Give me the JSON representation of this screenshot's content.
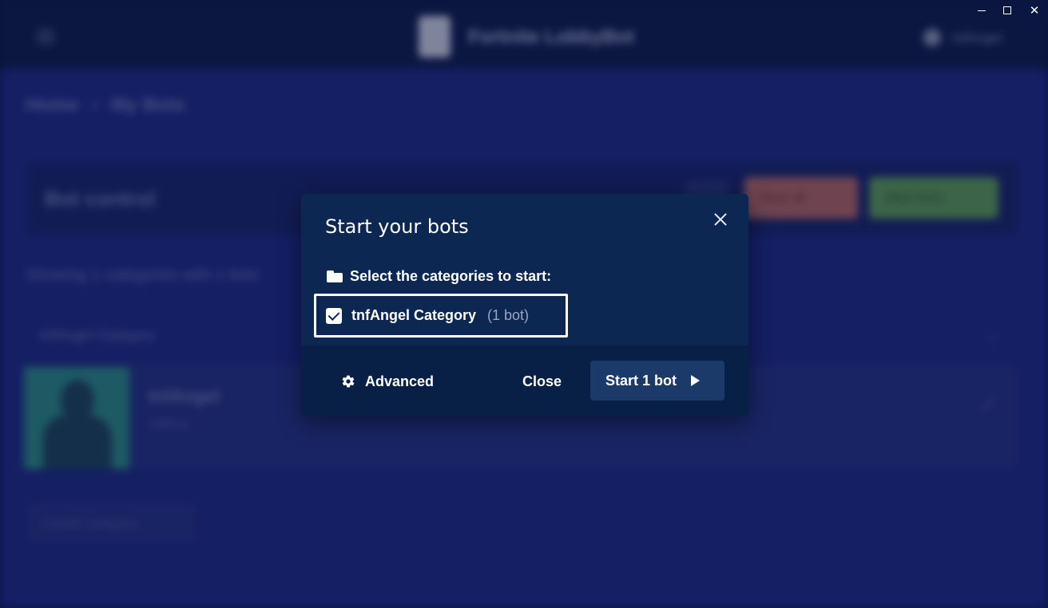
{
  "background": {
    "app_title": "Fortnite LobbyBot",
    "user_name": "tnfAngel",
    "breadcrumb": [
      "Home",
      "My Bots"
    ],
    "breadcrumb_separator": "›",
    "control_title": "Bot control",
    "stop_all_label": "Stop all",
    "start_bots_label": "Start bots",
    "showing_text": "Showing 1 categories with 1 bots",
    "category_row_text": "tnfAngel Category",
    "bot_name": "tnfAngel",
    "bot_status": "Offline",
    "create_category_label": "Create category",
    "colors": {
      "app_bg": "#1e2a8a",
      "topbar_bg": "#0f1d52",
      "stop_button": "#b0666a",
      "start_button": "#5e9a5e"
    }
  },
  "window_controls": {
    "minimize_icon": "minimize-icon",
    "maximize_icon": "maximize-icon",
    "close_symbol": "✕"
  },
  "dialog": {
    "title": "Start your bots",
    "section_label": "Select the categories to start:",
    "section_icon": "folder-icon",
    "categories": [
      {
        "name": "tnfAngel Category",
        "count": "(1 bot)",
        "checked": true
      }
    ],
    "footer": {
      "advanced_label": "Advanced",
      "advanced_icon": "gear-icon",
      "close_label": "Close",
      "start_label": "Start 1 bot",
      "start_icon": "play-icon"
    },
    "colors": {
      "dialog_bg": "#0c2752",
      "footer_bg": "#082046",
      "start_button_bg": "#1b3a6a",
      "muted_text": "#9aa6c4"
    }
  }
}
